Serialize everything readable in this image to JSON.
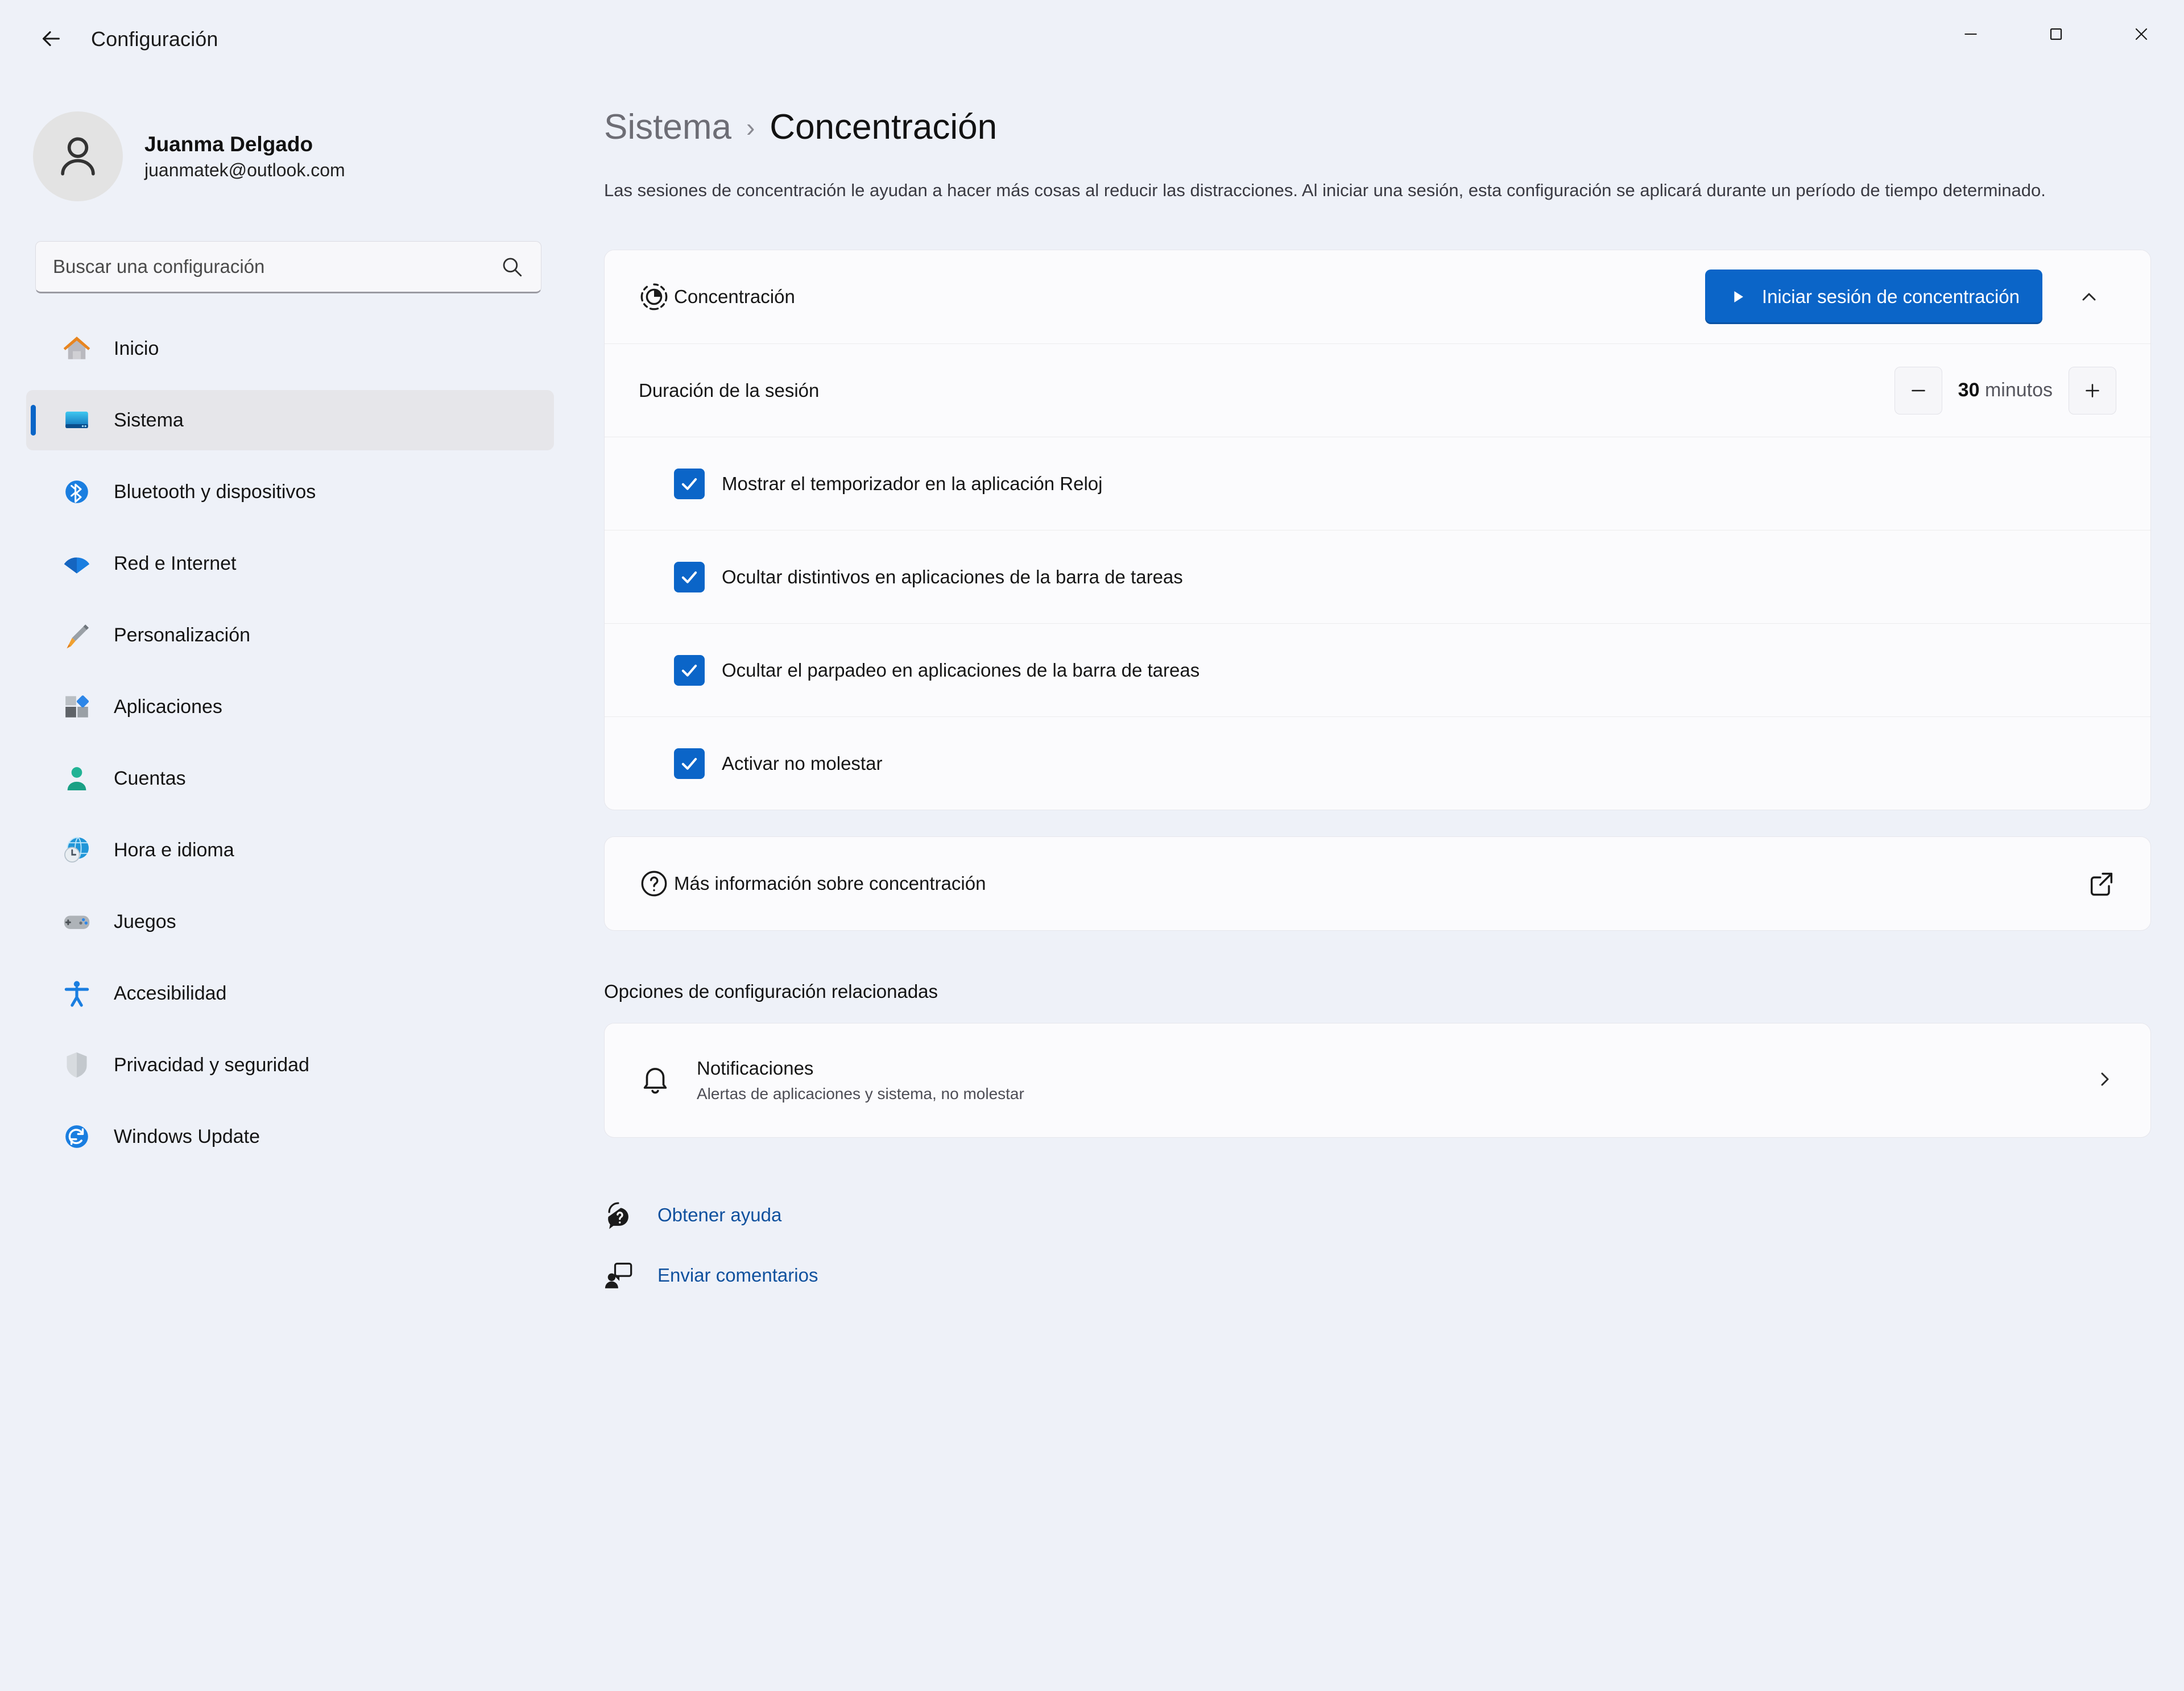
{
  "window": {
    "app_title": "Configuración",
    "back_icon": "back-arrow-icon",
    "minimize_label": "Minimizar",
    "maximize_label": "Maximizar",
    "close_label": "Cerrar"
  },
  "account": {
    "name": "Juanma Delgado",
    "email": "juanmatek@outlook.com",
    "avatar_icon": "person-icon"
  },
  "search": {
    "placeholder": "Buscar una configuración",
    "value": "",
    "icon": "search-icon"
  },
  "sidebar": {
    "items": [
      {
        "label": "Inicio",
        "icon": "home-icon",
        "selected": false
      },
      {
        "label": "Sistema",
        "icon": "system-monitor-icon",
        "selected": true
      },
      {
        "label": "Bluetooth y dispositivos",
        "icon": "bluetooth-icon",
        "selected": false
      },
      {
        "label": "Red e Internet",
        "icon": "wifi-icon",
        "selected": false
      },
      {
        "label": "Personalización",
        "icon": "paintbrush-icon",
        "selected": false
      },
      {
        "label": "Aplicaciones",
        "icon": "apps-icon",
        "selected": false
      },
      {
        "label": "Cuentas",
        "icon": "account-person-icon",
        "selected": false
      },
      {
        "label": "Hora e idioma",
        "icon": "clock-globe-icon",
        "selected": false
      },
      {
        "label": "Juegos",
        "icon": "gamepad-icon",
        "selected": false
      },
      {
        "label": "Accesibilidad",
        "icon": "accessibility-person-icon",
        "selected": false
      },
      {
        "label": "Privacidad y seguridad",
        "icon": "shield-icon",
        "selected": false
      },
      {
        "label": "Windows Update",
        "icon": "update-refresh-icon",
        "selected": false
      }
    ]
  },
  "breadcrumb": {
    "parent": "Sistema",
    "separator": "›",
    "current": "Concentración"
  },
  "page": {
    "description": "Las sesiones de concentración le ayudan a hacer más cosas al reducir las distracciones. Al iniciar una sesión, esta configuración se aplicará durante un período de tiempo determinado."
  },
  "focus_card": {
    "icon": "focus-timer-icon",
    "title": "Concentración",
    "start_button": {
      "label": "Iniciar sesión de concentración",
      "icon": "play-icon"
    },
    "collapse_icon": "chevron-up-icon",
    "duration": {
      "label": "Duración de la sesión",
      "decrement_icon": "minus-icon",
      "increment_icon": "plus-icon",
      "value": "30",
      "unit": "minutos"
    },
    "checkboxes": [
      {
        "label": "Mostrar el temporizador en la aplicación Reloj",
        "checked": true
      },
      {
        "label": "Ocultar distintivos en aplicaciones de la barra de tareas",
        "checked": true
      },
      {
        "label": "Ocultar el parpadeo en aplicaciones de la barra de tareas",
        "checked": true
      },
      {
        "label": "Activar no molestar",
        "checked": true
      }
    ]
  },
  "learn_more": {
    "icon": "question-circle-icon",
    "label": "Más información sobre concentración",
    "external_icon": "external-link-icon"
  },
  "related": {
    "heading": "Opciones de configuración relacionadas",
    "item": {
      "icon": "bell-icon",
      "title": "Notificaciones",
      "subtitle": "Alertas de aplicaciones y sistema, no molestar",
      "chevron_icon": "chevron-right-icon"
    }
  },
  "footer": {
    "links": [
      {
        "label": "Obtener ayuda",
        "icon": "help-question-icon"
      },
      {
        "label": "Enviar comentarios",
        "icon": "feedback-icon"
      }
    ]
  },
  "colors": {
    "accent": "#0b65c8",
    "page_background": "#eef1f8",
    "card_background": "#fbfbfd",
    "link": "#10519e"
  }
}
